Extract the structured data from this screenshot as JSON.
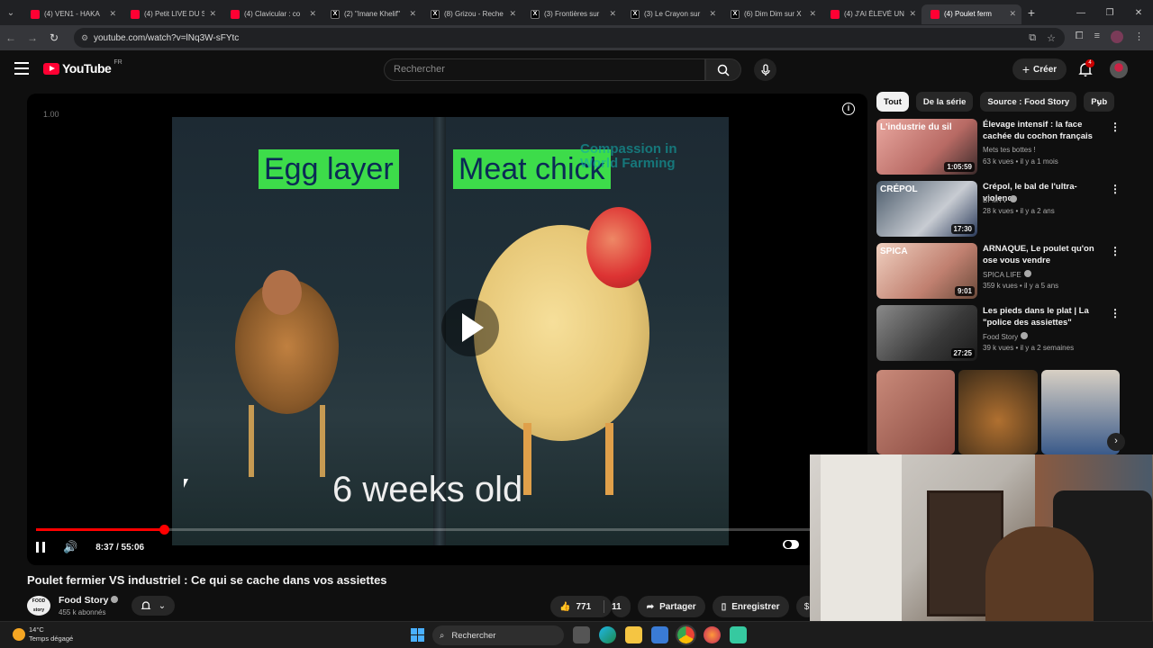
{
  "browser": {
    "tabs": [
      {
        "title": "(4) VEN1 - HAKA",
        "fav": "yt"
      },
      {
        "title": "(4) Petit LIVE DU S",
        "fav": "yt"
      },
      {
        "title": "(4) Clavicular : co",
        "fav": "yt"
      },
      {
        "title": "(2) \"Imane Khelif\"",
        "fav": "x"
      },
      {
        "title": "(8) Grizou - Reche",
        "fav": "x"
      },
      {
        "title": "(3) Frontières sur",
        "fav": "x"
      },
      {
        "title": "(3) Le Crayon sur",
        "fav": "x"
      },
      {
        "title": "(6) Dim Dim sur X",
        "fav": "x"
      },
      {
        "title": "(4) J'AI ÉLEVÉ UN",
        "fav": "yt"
      },
      {
        "title": "(4) Poulet ferm",
        "fav": "yt",
        "active": true
      }
    ],
    "url": "youtube.com/watch?v=lNq3W-sFYtc"
  },
  "header": {
    "logo_text": "YouTube",
    "country": "FR",
    "search_placeholder": "Rechercher",
    "create_label": "Créer",
    "notification_count": "4"
  },
  "player": {
    "zoom": "1.00",
    "label_left": "Egg layer",
    "label_right": "Meat chick",
    "watermark": "Compassion in World Farming",
    "caption": "6 weeks old",
    "time": "8:37 / 55:06",
    "progress": 0.156
  },
  "video": {
    "title": "Poulet fermier VS industriel : Ce qui se cache dans vos assiettes",
    "channel": "Food Story",
    "channel_logo": "FOOD story",
    "subscribers": "455 k abonnés",
    "likes": "771",
    "dislike": "11",
    "share_label": "Partager",
    "save_label": "Enregistrer"
  },
  "chips": [
    "Tout",
    "De la série",
    "Source : Food Story",
    "Pub"
  ],
  "recommendations": [
    {
      "title": "Élevage intensif : la face cachée du cochon français",
      "channel": "Mets tes bottes !",
      "meta": "63 k vues • il y a 1 mois",
      "duration": "1:05:59",
      "thumb_text": "L'industrie du sil",
      "verified": false
    },
    {
      "title": "Crépol, le bal de l'ultra-violence",
      "channel": "BFMTV",
      "meta": "28 k vues • il y a 2 ans",
      "duration": "17:30",
      "thumb_text": "CRÉPOL",
      "verified": true
    },
    {
      "title": "ARNAQUE, Le poulet qu'on ose vous vendre",
      "channel": "SPICA LIFE",
      "meta": "359 k vues • il y a 5 ans",
      "duration": "9:01",
      "thumb_text": "SPICA",
      "verified": true
    },
    {
      "title": "Les pieds dans le plat | La \"police des assiettes\"",
      "channel": "Food Story",
      "meta": "39 k vues • il y a 2 semaines",
      "duration": "27:25",
      "thumb_text": "",
      "verified": true
    }
  ],
  "taskbar": {
    "temp": "14°C",
    "weather": "Temps dégagé",
    "search_label": "Rechercher"
  },
  "colors": {
    "accent": "#ff0033",
    "progress": "#ff0000",
    "label_green": "#3ddc4a"
  }
}
